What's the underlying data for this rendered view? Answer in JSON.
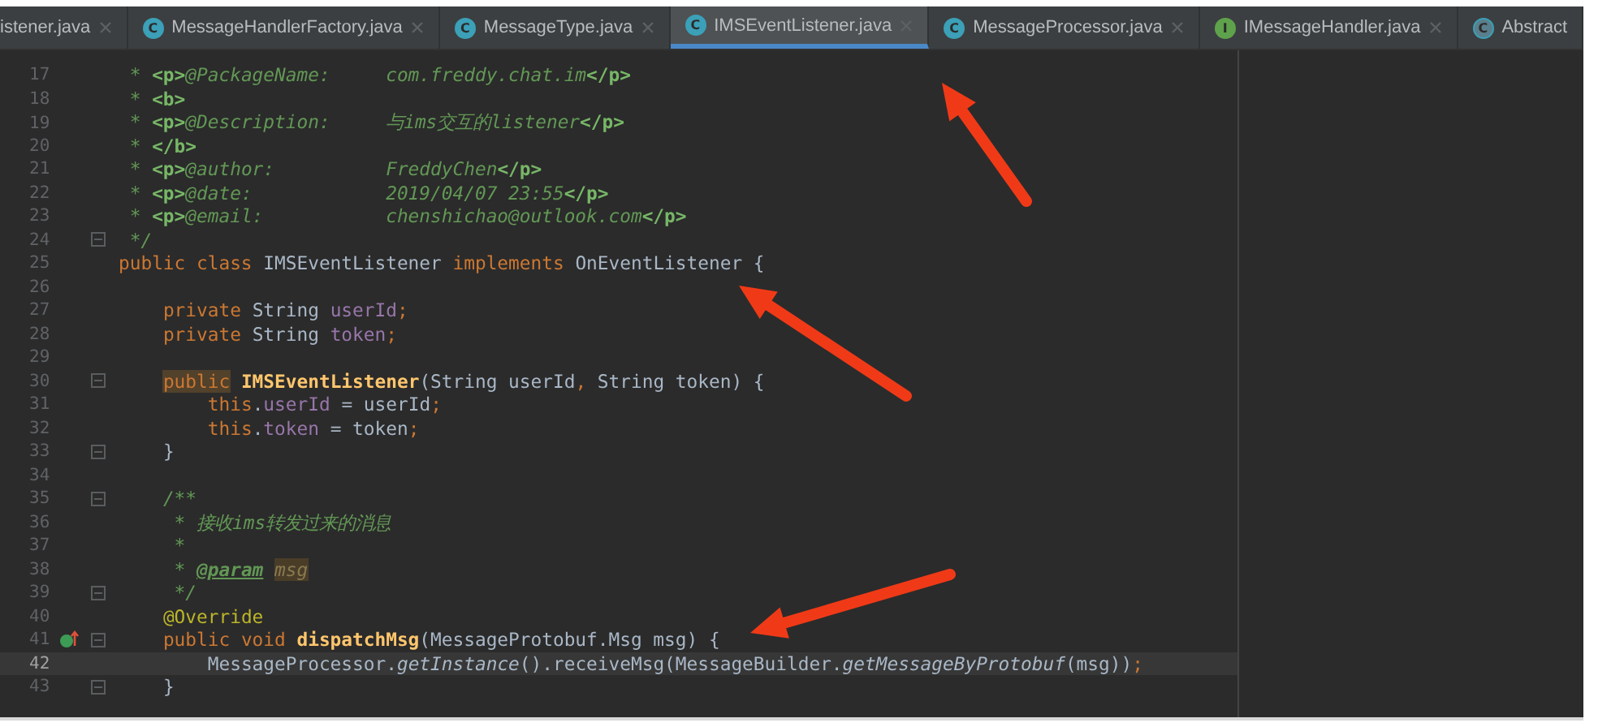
{
  "tabs": [
    {
      "label": "istener.java",
      "selected": false,
      "closable": true
    },
    {
      "label": "MessageHandlerFactory.java",
      "icon_letter": "C",
      "kind": "class",
      "selected": false,
      "closable": true
    },
    {
      "label": "MessageType.java",
      "icon_letter": "C",
      "kind": "class",
      "selected": false,
      "closable": true
    },
    {
      "label": "IMSEventListener.java",
      "icon_letter": "C",
      "kind": "class",
      "selected": true,
      "closable": true
    },
    {
      "label": "MessageProcessor.java",
      "icon_letter": "C",
      "kind": "class",
      "selected": false,
      "closable": true
    },
    {
      "label": "IMessageHandler.java",
      "icon_letter": "I",
      "kind": "interface",
      "selected": false,
      "closable": true
    },
    {
      "label": "Abstract",
      "icon_letter": "C",
      "kind": "abstract",
      "selected": false,
      "closable": false
    }
  ],
  "lines": [
    {
      "n": "17",
      "fold": false,
      "marker": false,
      "current": false,
      "tokens": [
        {
          "kind": "doc",
          "t": " * "
        },
        {
          "kind": "doctag",
          "t": "<p>"
        },
        {
          "kind": "doc",
          "t": "@PackageName:     com.freddy.chat.im"
        },
        {
          "kind": "doctag",
          "t": "</p>"
        }
      ]
    },
    {
      "n": "18",
      "fold": false,
      "marker": false,
      "current": false,
      "tokens": [
        {
          "kind": "doc",
          "t": " * "
        },
        {
          "kind": "doctag",
          "t": "<b>"
        }
      ]
    },
    {
      "n": "19",
      "fold": false,
      "marker": false,
      "current": false,
      "tokens": [
        {
          "kind": "doc",
          "t": " * "
        },
        {
          "kind": "doctag",
          "t": "<p>"
        },
        {
          "kind": "doc",
          "t": "@Description:     与ims交互的listener"
        },
        {
          "kind": "doctag",
          "t": "</p>"
        }
      ]
    },
    {
      "n": "20",
      "fold": false,
      "marker": false,
      "current": false,
      "tokens": [
        {
          "kind": "doc",
          "t": " * "
        },
        {
          "kind": "doctag",
          "t": "</b>"
        }
      ]
    },
    {
      "n": "21",
      "fold": false,
      "marker": false,
      "current": false,
      "tokens": [
        {
          "kind": "doc",
          "t": " * "
        },
        {
          "kind": "doctag",
          "t": "<p>"
        },
        {
          "kind": "doc",
          "t": "@author:          FreddyChen"
        },
        {
          "kind": "doctag",
          "t": "</p>"
        }
      ]
    },
    {
      "n": "22",
      "fold": false,
      "marker": false,
      "current": false,
      "tokens": [
        {
          "kind": "doc",
          "t": " * "
        },
        {
          "kind": "doctag",
          "t": "<p>"
        },
        {
          "kind": "doc",
          "t": "@date:            2019/04/07 23:55"
        },
        {
          "kind": "doctag",
          "t": "</p>"
        }
      ]
    },
    {
      "n": "23",
      "fold": false,
      "marker": false,
      "current": false,
      "tokens": [
        {
          "kind": "doc",
          "t": " * "
        },
        {
          "kind": "doctag",
          "t": "<p>"
        },
        {
          "kind": "doc",
          "t": "@email:           chenshichao@outlook.com"
        },
        {
          "kind": "doctag",
          "t": "</p>"
        }
      ]
    },
    {
      "n": "24",
      "fold": true,
      "marker": false,
      "current": false,
      "tokens": [
        {
          "kind": "doc",
          "t": " */"
        }
      ]
    },
    {
      "n": "25",
      "fold": false,
      "marker": false,
      "current": false,
      "tokens": [
        {
          "kind": "kw",
          "t": "public class "
        },
        {
          "kind": "plain",
          "t": "IMSEventListener "
        },
        {
          "kind": "kw",
          "t": "implements "
        },
        {
          "kind": "plain",
          "t": "OnEventListener {"
        }
      ]
    },
    {
      "n": "26",
      "fold": false,
      "marker": false,
      "current": false
    },
    {
      "n": "27",
      "fold": false,
      "marker": false,
      "current": false,
      "tokens": [
        {
          "kind": "kw",
          "t": "    private "
        },
        {
          "kind": "plain",
          "t": "String "
        },
        {
          "kind": "field",
          "t": "userId"
        },
        {
          "kind": "kw",
          "t": ";"
        }
      ]
    },
    {
      "n": "28",
      "fold": false,
      "marker": false,
      "current": false,
      "tokens": [
        {
          "kind": "kw",
          "t": "    private "
        },
        {
          "kind": "plain",
          "t": "String "
        },
        {
          "kind": "field",
          "t": "token"
        },
        {
          "kind": "kw",
          "t": ";"
        }
      ]
    },
    {
      "n": "29",
      "fold": false,
      "marker": false,
      "current": false
    },
    {
      "n": "30",
      "fold": true,
      "marker": false,
      "current": false,
      "tokens": [
        {
          "kind": "kwhl",
          "t": "    public "
        },
        {
          "kind": "method",
          "t": "IMSEventListener"
        },
        {
          "kind": "plain",
          "t": "(String userId"
        },
        {
          "kind": "kw",
          "t": ","
        },
        {
          "kind": "plain",
          "t": " String token) {"
        }
      ]
    },
    {
      "n": "31",
      "fold": false,
      "marker": false,
      "current": false,
      "tokens": [
        {
          "kind": "kw",
          "t": "        this"
        },
        {
          "kind": "plain",
          "t": "."
        },
        {
          "kind": "field",
          "t": "userId"
        },
        {
          "kind": "plain",
          "t": " = userId"
        },
        {
          "kind": "kw",
          "t": ";"
        }
      ]
    },
    {
      "n": "32",
      "fold": false,
      "marker": false,
      "current": false,
      "tokens": [
        {
          "kind": "kw",
          "t": "        this"
        },
        {
          "kind": "plain",
          "t": "."
        },
        {
          "kind": "field",
          "t": "token"
        },
        {
          "kind": "plain",
          "t": " = token"
        },
        {
          "kind": "kw",
          "t": ";"
        }
      ]
    },
    {
      "n": "33",
      "fold": true,
      "marker": false,
      "current": false,
      "tokens": [
        {
          "kind": "plain",
          "t": "    }"
        }
      ]
    },
    {
      "n": "34",
      "fold": false,
      "marker": false,
      "current": false
    },
    {
      "n": "35",
      "fold": true,
      "marker": false,
      "current": false,
      "tokens": [
        {
          "kind": "doc",
          "t": "    /**"
        }
      ]
    },
    {
      "n": "36",
      "fold": false,
      "marker": false,
      "current": false,
      "tokens": [
        {
          "kind": "doc",
          "t": "     * 接收ims转发过来的消息"
        }
      ]
    },
    {
      "n": "37",
      "fold": false,
      "marker": false,
      "current": false,
      "tokens": [
        {
          "kind": "doc",
          "t": "     *"
        }
      ]
    },
    {
      "n": "38",
      "fold": false,
      "marker": false,
      "current": false,
      "tokens": [
        {
          "kind": "doc",
          "t": "     * "
        },
        {
          "kind": "docref",
          "t": "@param"
        },
        {
          "kind": "paramhl",
          "t": " msg"
        }
      ]
    },
    {
      "n": "39",
      "fold": true,
      "marker": false,
      "current": false,
      "tokens": [
        {
          "kind": "doc",
          "t": "     */"
        }
      ]
    },
    {
      "n": "40",
      "fold": false,
      "marker": false,
      "current": false,
      "tokens": [
        {
          "kind": "annotation",
          "t": "    @Override"
        }
      ]
    },
    {
      "n": "41",
      "fold": true,
      "marker": true,
      "current": false,
      "tokens": [
        {
          "kind": "kw",
          "t": "    public void "
        },
        {
          "kind": "method",
          "t": "dispatchMsg"
        },
        {
          "kind": "plain",
          "t": "(MessageProtobuf.Msg msg) {"
        }
      ]
    },
    {
      "n": "42",
      "fold": false,
      "marker": false,
      "current": true,
      "tokens": [
        {
          "kind": "plain",
          "t": "        MessageProcessor."
        },
        {
          "kind": "static",
          "t": "getInstance"
        },
        {
          "kind": "plain",
          "t": "().receiveMsg(MessageBuilder."
        },
        {
          "kind": "static",
          "t": "getMessageByProtobuf"
        },
        {
          "kind": "plain",
          "t": "(msg))"
        },
        {
          "kind": "kw",
          "t": ";"
        }
      ]
    },
    {
      "n": "43",
      "fold": true,
      "marker": false,
      "current": false,
      "tokens": [
        {
          "kind": "plain",
          "t": "    }"
        }
      ]
    }
  ]
}
